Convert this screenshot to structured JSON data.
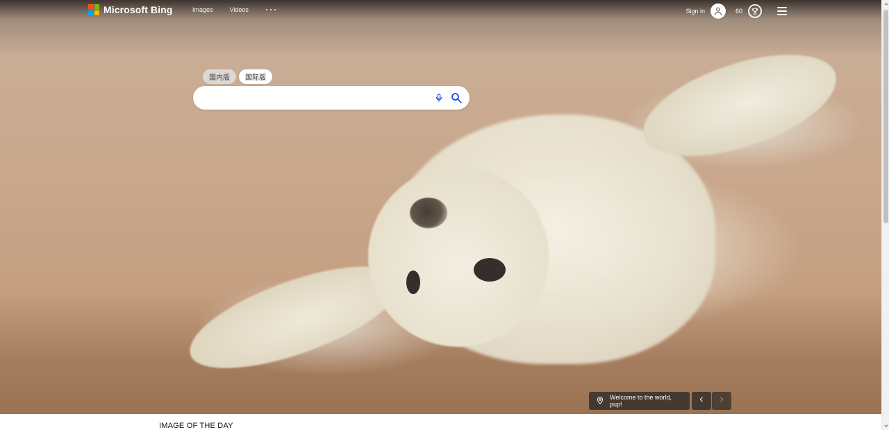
{
  "header": {
    "brand": "Microsoft Bing",
    "nav": {
      "images": "Images",
      "videos": "Videos"
    },
    "user": {
      "sign_in": "Sign in",
      "points": "60"
    }
  },
  "search": {
    "market_tabs": [
      {
        "label": "国内版",
        "selected": false
      },
      {
        "label": "国际版",
        "selected": true
      }
    ],
    "value": "",
    "placeholder": ""
  },
  "hero": {
    "caption": "Welcome to the world, pup!"
  },
  "footer": {
    "section_title": "IMAGE OF THE DAY"
  },
  "colors": {
    "ms_red": "#F25022",
    "ms_green": "#7FBA00",
    "ms_blue": "#00A4EF",
    "ms_yellow": "#FFB900",
    "bing_teal": "#174AE4"
  },
  "icons": [
    "microsoft-logo-icon",
    "more-dots-icon",
    "user-icon",
    "rewards-trophy-icon",
    "hamburger-menu-icon",
    "microphone-icon",
    "search-icon",
    "location-pin-icon",
    "chevron-left-icon",
    "chevron-right-icon",
    "scroll-up-icon",
    "scroll-down-icon"
  ]
}
